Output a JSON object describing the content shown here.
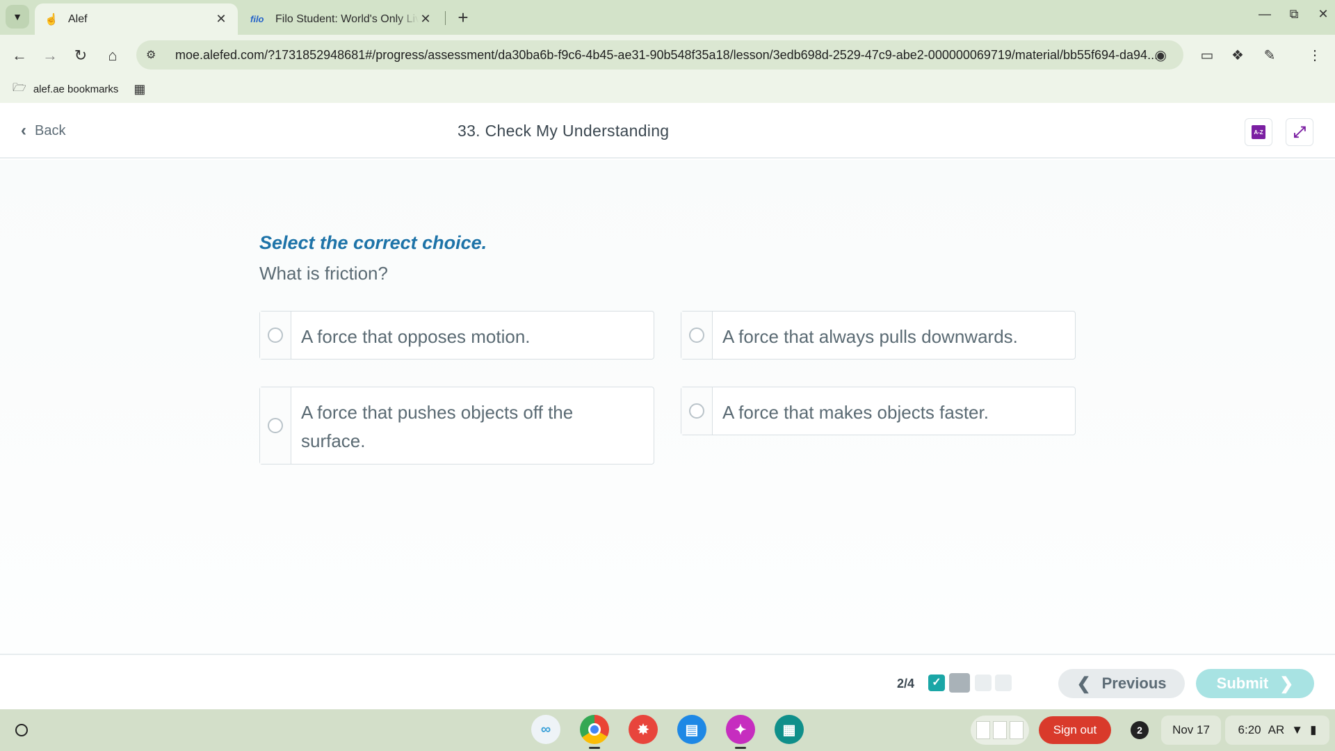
{
  "browser": {
    "tabs": [
      {
        "title": "Alef",
        "active": true
      },
      {
        "favicon_text": "filo",
        "title": "Filo Student: World's Only Live Instant Tutoring",
        "active": false
      }
    ],
    "url": "moe.alefed.com/?1731852948681#/progress/assessment/da30ba6b-f9c6-4b45-ae31-90b548f35a18/lesson/3edb698d-2529-47c9-abe2-000000069719/material/bb55f694-da94...",
    "bookmarks": [
      {
        "label": "alef.ae bookmarks"
      }
    ]
  },
  "header": {
    "back_label": "Back",
    "title": "33. Check My Understanding"
  },
  "question": {
    "instruction": "Select the correct choice.",
    "prompt": "What is friction?",
    "choices": [
      {
        "label": "A force that opposes motion."
      },
      {
        "label": "A force that always pulls downwards."
      },
      {
        "label": "A force that pushes objects off the surface."
      },
      {
        "label": "A force that makes objects faster."
      }
    ]
  },
  "footer": {
    "progress_text": "2/4",
    "previous_label": "Previous",
    "submit_label": "Submit"
  },
  "shelf": {
    "signout_label": "Sign out",
    "notification_count": "2",
    "date": "Nov 17",
    "time": "6:20",
    "ime": "AR"
  },
  "colors": {
    "accent": "#1d73a8",
    "progress_done": "#1aa6a6",
    "submit_disabled": "#a8e3e3",
    "signout": "#d93a2b"
  }
}
